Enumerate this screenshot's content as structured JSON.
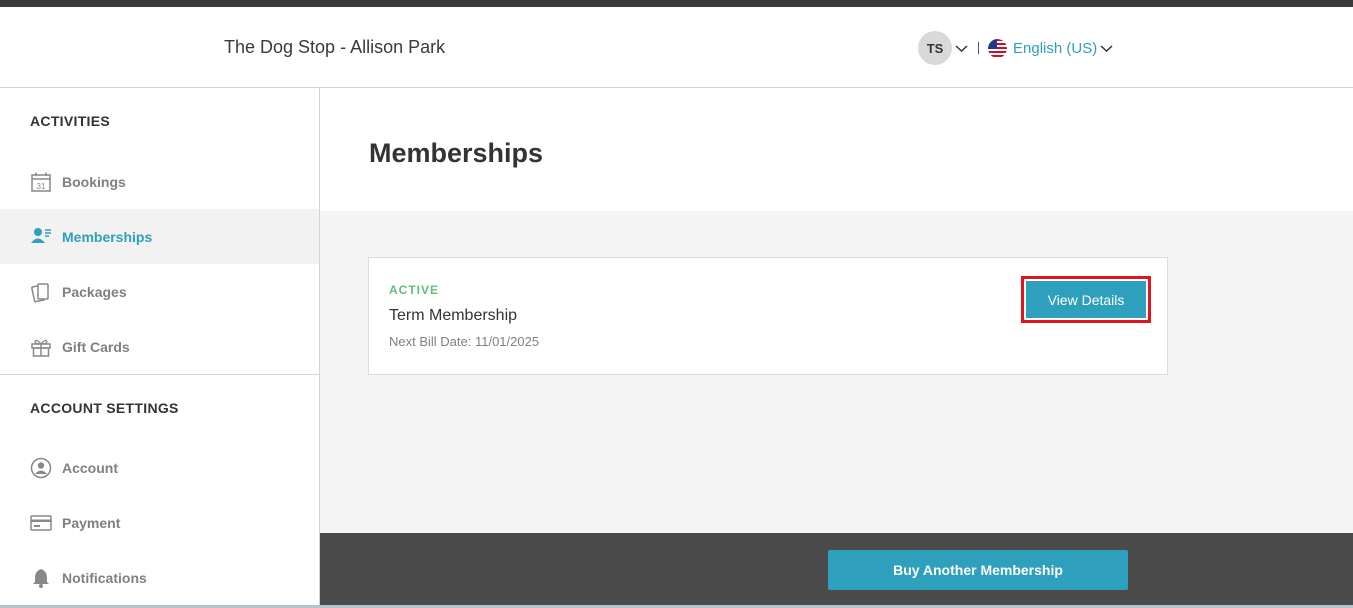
{
  "header": {
    "brand": "The Dog Stop - Allison Park",
    "user_initials": "TS",
    "language": "English (US)"
  },
  "sidebar": {
    "activities_title": "ACTIVITIES",
    "activities": [
      {
        "label": "Bookings",
        "icon": "calendar-icon",
        "active": false
      },
      {
        "label": "Memberships",
        "icon": "membership-icon",
        "active": true
      },
      {
        "label": "Packages",
        "icon": "packages-icon",
        "active": false
      },
      {
        "label": "Gift Cards",
        "icon": "gift-icon",
        "active": false
      }
    ],
    "settings_title": "ACCOUNT SETTINGS",
    "settings": [
      {
        "label": "Account",
        "icon": "account-icon"
      },
      {
        "label": "Payment",
        "icon": "payment-card-icon"
      },
      {
        "label": "Notifications",
        "icon": "bell-icon"
      }
    ]
  },
  "main": {
    "page_title": "Memberships",
    "membership": {
      "status": "ACTIVE",
      "name": "Term Membership",
      "next_bill": "Next Bill Date: 11/01/2025",
      "view_details_label": "View Details"
    },
    "buy_another_label": "Buy Another Membership"
  },
  "colors": {
    "accent": "#2e9fbc",
    "active_status": "#5fbf7a",
    "highlight_outline": "#e0141e",
    "footer_bar": "#4a4a4a"
  }
}
